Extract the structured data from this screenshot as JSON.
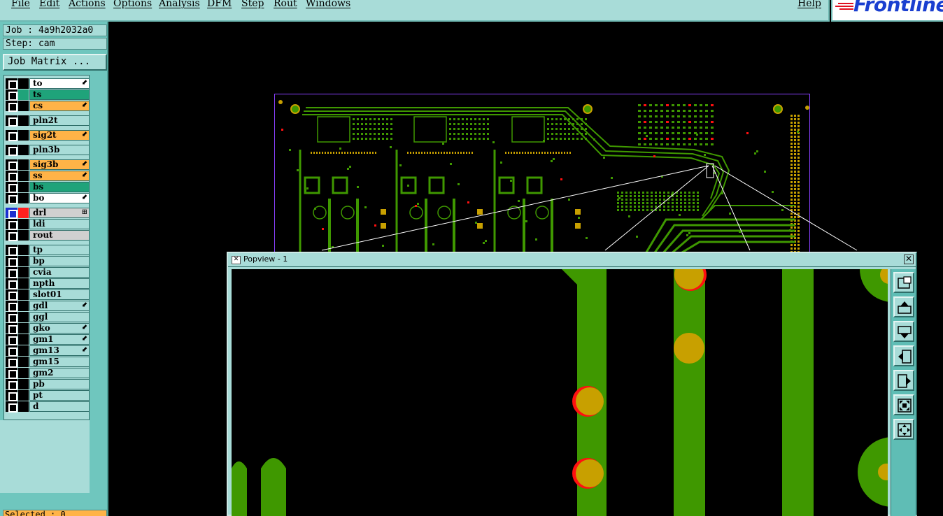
{
  "menubar": {
    "items": [
      "File",
      "Edit",
      "Actions",
      "Options",
      "Analysis",
      "DFM",
      "Step",
      "Rout",
      "Windows"
    ],
    "help": "Help"
  },
  "logo": {
    "text": "Frontline"
  },
  "job": {
    "job_label": "Job : 4a9h2032a0",
    "step_label": "Step: cam",
    "job_matrix_button": "Job Matrix ..."
  },
  "layers": [
    {
      "name": "to",
      "bg": "white",
      "mark": "⬋",
      "color": ""
    },
    {
      "name": "ts",
      "bg": "green",
      "mark": "",
      "color": "#1fa37a"
    },
    {
      "name": "cs",
      "bg": "orange",
      "mark": "⬋",
      "color": ""
    },
    {
      "name": "pln2t",
      "bg": "default",
      "mark": "",
      "color": ""
    },
    {
      "name": "sig2t",
      "bg": "orange",
      "mark": "⬋",
      "color": ""
    },
    {
      "name": "pln3b",
      "bg": "default",
      "mark": "",
      "color": ""
    },
    {
      "name": "sig3b",
      "bg": "orange",
      "mark": "⬋",
      "color": ""
    },
    {
      "name": "ss",
      "bg": "orange",
      "mark": "⬋",
      "color": ""
    },
    {
      "name": "bs",
      "bg": "green",
      "mark": "",
      "color": ""
    },
    {
      "name": "bo",
      "bg": "white",
      "mark": "⬋",
      "color": ""
    },
    {
      "name": "drl",
      "bg": "grey",
      "mark": "⊞",
      "color": "#ff2020",
      "selected": true
    },
    {
      "name": "ldi",
      "bg": "default",
      "mark": "",
      "color": ""
    },
    {
      "name": "rout",
      "bg": "grey",
      "mark": "",
      "color": ""
    },
    {
      "name": "tp",
      "bg": "default",
      "mark": "",
      "color": ""
    },
    {
      "name": "bp",
      "bg": "default",
      "mark": "",
      "color": ""
    },
    {
      "name": "cvia",
      "bg": "default",
      "mark": "",
      "color": ""
    },
    {
      "name": "npth",
      "bg": "default",
      "mark": "",
      "color": ""
    },
    {
      "name": "slot01",
      "bg": "default",
      "mark": "",
      "color": ""
    },
    {
      "name": "gdl",
      "bg": "default",
      "mark": "⬋",
      "color": ""
    },
    {
      "name": "ggl",
      "bg": "default",
      "mark": "",
      "color": ""
    },
    {
      "name": "gko",
      "bg": "default",
      "mark": "⬋",
      "color": ""
    },
    {
      "name": "gm1",
      "bg": "default",
      "mark": "⬋",
      "color": ""
    },
    {
      "name": "gm13",
      "bg": "default",
      "mark": "⬋",
      "color": ""
    },
    {
      "name": "gm15",
      "bg": "default",
      "mark": "",
      "color": ""
    },
    {
      "name": "gm2",
      "bg": "default",
      "mark": "",
      "color": ""
    },
    {
      "name": "pb",
      "bg": "default",
      "mark": "",
      "color": ""
    },
    {
      "name": "pt",
      "bg": "default",
      "mark": "",
      "color": ""
    },
    {
      "name": "d",
      "bg": "default",
      "mark": "",
      "color": ""
    }
  ],
  "status": {
    "selected": "Selected : 0"
  },
  "popview": {
    "title": "Popview - 1",
    "close": "✕",
    "tools": [
      "zoom-window-icon",
      "pan-up-icon",
      "pan-down-icon",
      "pan-left-icon",
      "pan-right-icon",
      "zoom-fit-icon",
      "zoom-center-icon"
    ]
  },
  "colors": {
    "trace": "#3f9800",
    "pad": "#c8a000",
    "drill": "#ff1010",
    "panel": "#a8dcd8",
    "panel_dark": "#6fc6be"
  }
}
